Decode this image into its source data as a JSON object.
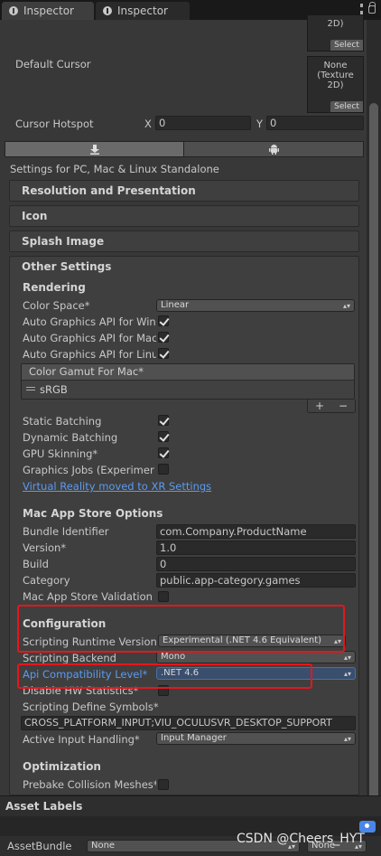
{
  "tabs": [
    {
      "label": "Inspector",
      "active": true
    },
    {
      "label": "Inspector",
      "active": false
    }
  ],
  "icons": [
    "info-icon",
    "kebab-menu-icon",
    "lock-icon",
    "download-icon",
    "android-icon",
    "checkmark-icon",
    "tag-icon"
  ],
  "cursor": {
    "top_tex_text": "2D)",
    "select_label": "Select",
    "default_cursor_label": "Default Cursor",
    "default_tex_text_1": "None",
    "default_tex_text_2": "(Texture",
    "default_tex_text_3": "2D)",
    "hotspot_label": "Cursor Hotspot",
    "x_label": "X",
    "x_value": "0",
    "y_label": "Y",
    "y_value": "0"
  },
  "platform": {
    "settings_for": "Settings for PC, Mac & Linux Standalone"
  },
  "sections": {
    "resolution": "Resolution and Presentation",
    "icon": "Icon",
    "splash": "Splash Image",
    "other": "Other Settings"
  },
  "rendering": {
    "header": "Rendering",
    "color_space_label": "Color Space*",
    "color_space_value": "Linear",
    "auto_api_win": "Auto Graphics API for Win",
    "auto_api_mac": "Auto Graphics API for Mac",
    "auto_api_linux": "Auto Graphics API for Linu",
    "gamut_header": "Color Gamut For Mac*",
    "gamut_item": "sRGB",
    "plus": "+",
    "minus": "−",
    "static_batching": "Static Batching",
    "dynamic_batching": "Dynamic Batching",
    "gpu_skinning": "GPU Skinning*",
    "graphics_jobs": "Graphics Jobs (Experimer",
    "vr_link": "Virtual Reality moved to XR Settings"
  },
  "mac_store": {
    "header": "Mac App Store Options",
    "bundle_id_label": "Bundle Identifier",
    "bundle_id_value": "com.Company.ProductName",
    "version_label": "Version*",
    "version_value": "1.0",
    "build_label": "Build",
    "build_value": "0",
    "category_label": "Category",
    "category_value": "public.app-category.games",
    "validation_label": "Mac App Store Validation"
  },
  "configuration": {
    "header": "Configuration",
    "runtime_label": "Scripting Runtime Version",
    "runtime_value": "Experimental (.NET 4.6 Equivalent)",
    "backend_label": "Scripting Backend",
    "backend_value": "Mono",
    "api_label": "Api Compatibility Level*",
    "api_value": ".NET 4.6",
    "hw_stats_label": "Disable HW Statistics*",
    "define_symbols_label": "Scripting Define Symbols*",
    "define_symbols_value": "CROSS_PLATFORM_INPUT;VIU_OCULUSVR_DESKTOP_SUPPORT",
    "input_label": "Active Input Handling*",
    "input_value": "Input Manager"
  },
  "optimization": {
    "header": "Optimization",
    "prebake_label": "Prebake Collision Meshes*"
  },
  "asset_labels": {
    "title": "Asset Labels",
    "bundle_label": "AssetBundle",
    "bundle_value": "None",
    "variant_value": "None"
  },
  "watermark": "CSDN @Cheers_HYT",
  "colors": {
    "background": "#383838",
    "link": "#5a9bf0",
    "annotation_red": "#e5161b",
    "tag_blue": "#4a86e8"
  }
}
